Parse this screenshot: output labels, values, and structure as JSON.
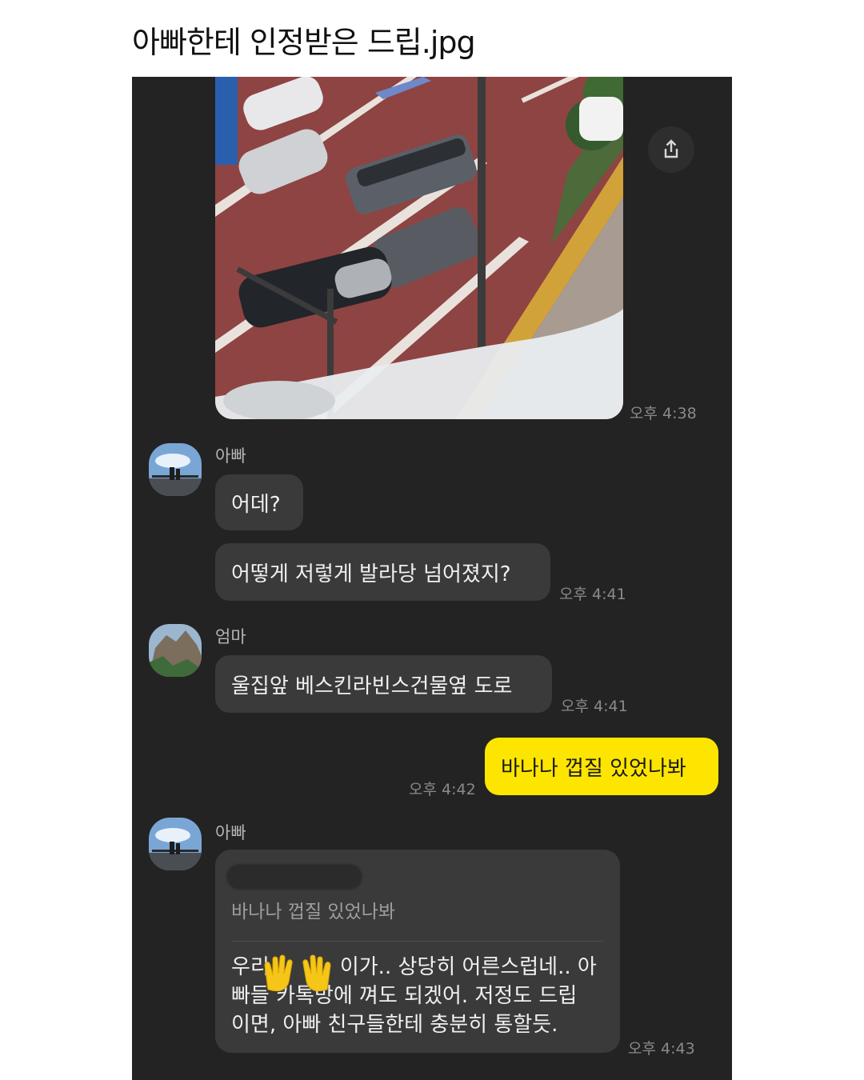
{
  "post": {
    "title": "아빠한테 인정받은 드립.jpg"
  },
  "chat": {
    "photo_message": {
      "time": "오후 4:38"
    },
    "messages": [
      {
        "sender": "아빠",
        "lines": [
          "어데?",
          "어떻게 저렇게 발라당 넘어졌지?"
        ],
        "time": "오후 4:41"
      },
      {
        "sender": "엄마",
        "lines": [
          "울집앞 베스킨라빈스건물옆 도로"
        ],
        "time": "오후 4:41"
      },
      {
        "mine": true,
        "text": "바나나 껍질 있었나봐",
        "time": "오후 4:42"
      },
      {
        "sender": "아빠",
        "quoted": "바나나 껍질 있었나봐",
        "reply_lines": [
          "우리",
          "이가.. 상당히 어른스럽네.. 아",
          "빠들 카톡방에 껴도 되겠어. 저정도 드립",
          "이면, 아빠 친구들한테 충분히 통할듯."
        ],
        "reply_emoji": "raising-hands-emoji",
        "time": "오후 4:43"
      }
    ]
  },
  "icons": {
    "share": "share-icon"
  },
  "colors": {
    "chat_background": "#232323",
    "bubble": "#3a3a3a",
    "my_bubble": "#fee500"
  }
}
